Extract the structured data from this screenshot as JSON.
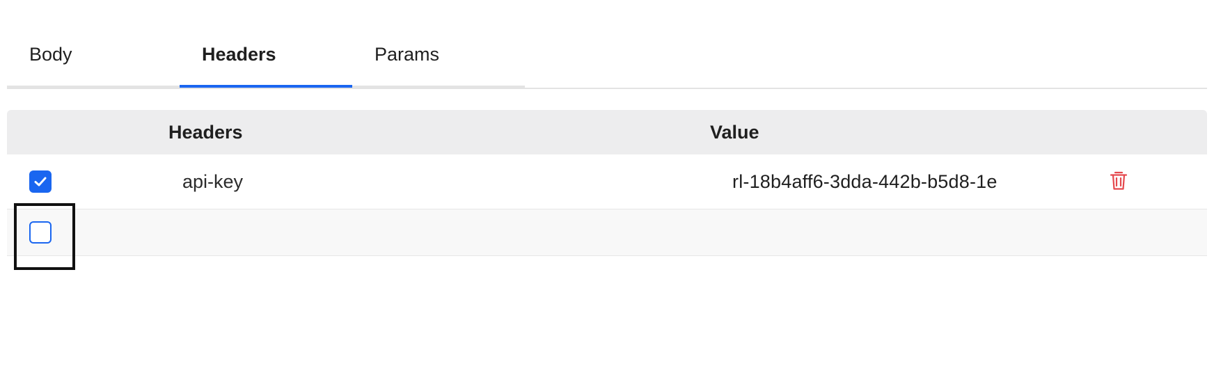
{
  "tabs": [
    {
      "label": "Body",
      "active": false
    },
    {
      "label": "Headers",
      "active": true
    },
    {
      "label": "Params",
      "active": false
    }
  ],
  "table": {
    "columns": {
      "headers": "Headers",
      "value": "Value"
    },
    "rows": [
      {
        "checked": true,
        "key": "api-key",
        "value": "rl-18b4aff6-3dda-442b-b5d8-1e",
        "delete_icon": "trash-icon"
      },
      {
        "checked": false,
        "key": "",
        "value": ""
      }
    ]
  },
  "colors": {
    "accent": "#1a66f0",
    "delete": "#e5484d",
    "header_bg": "#ededee",
    "focus_outline": "#111111"
  }
}
